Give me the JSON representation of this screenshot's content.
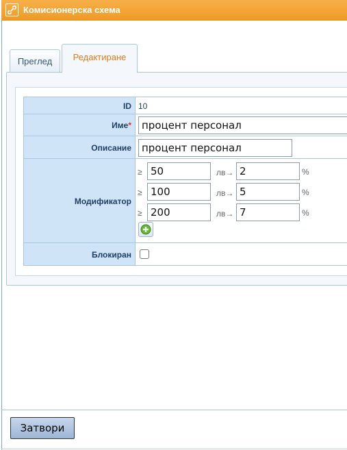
{
  "window": {
    "title": "Комисионерска схема",
    "title_icon": "link-icon"
  },
  "tabs": [
    {
      "label": "Преглед",
      "active": false
    },
    {
      "label": "Редактиране",
      "active": true
    }
  ],
  "form": {
    "id": {
      "label": "ID",
      "value": "10"
    },
    "name": {
      "label": "Име",
      "required_mark": "*",
      "value": "процент персонал"
    },
    "description": {
      "label": "Описание",
      "value": "процент персонал"
    },
    "modifier": {
      "label": "Модификатор",
      "rows": [
        {
          "op": "≥",
          "amount": "50",
          "unit": "лв",
          "arrow": "→",
          "percent": "2",
          "percent_sign": "%"
        },
        {
          "op": "≥",
          "amount": "100",
          "unit": "лв",
          "arrow": "→",
          "percent": "5",
          "percent_sign": "%"
        },
        {
          "op": "≥",
          "amount": "200",
          "unit": "лв",
          "arrow": "→",
          "percent": "7",
          "percent_sign": "%"
        }
      ],
      "add_icon": "plus-circle-icon"
    },
    "blocked": {
      "label": "Блокиран",
      "checked": false
    }
  },
  "footer": {
    "close_label": "Затвори"
  },
  "colors": {
    "titlebar": "#f09a25",
    "label_bg": "#cfe4f7",
    "active_tab_text": "#e07c1a",
    "label_text": "#1f3f66"
  }
}
